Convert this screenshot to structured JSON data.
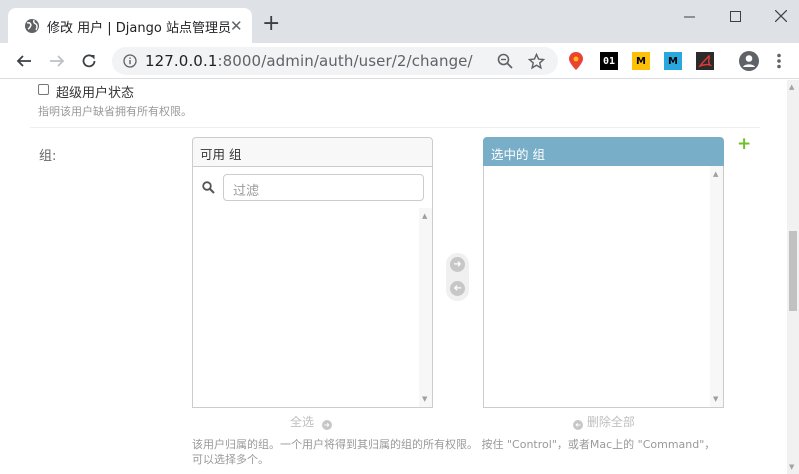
{
  "browser": {
    "tab_title": "修改 用户 | Django 站点管理员",
    "tab_close": "✕",
    "new_tab": "+",
    "url_host": "127.0.0.1",
    "url_rest": ":8000/admin/auth/user/2/change/",
    "extensions": [
      {
        "name": "maps-pin",
        "label": "",
        "bg": "#ffffff",
        "fg": "#ea4335"
      },
      {
        "name": "01",
        "label": "01",
        "bg": "#000000",
        "fg": "#ffffff"
      },
      {
        "name": "m-yellow",
        "label": "M",
        "bg": "#ffc107",
        "fg": "#000000"
      },
      {
        "name": "m-blue",
        "label": "M",
        "bg": "#29a8e0",
        "fg": "#000000"
      },
      {
        "name": "pdf",
        "label": "",
        "bg": "#2b2b2b",
        "fg": "#e53935"
      }
    ]
  },
  "form": {
    "superuser_label": "超级用户状态",
    "superuser_help": "指明该用户缺省拥有所有权限。",
    "groups_label": "组:",
    "available": {
      "title": "可用 组",
      "filter_placeholder": "过滤",
      "choose_all": "全选"
    },
    "chosen": {
      "title": "选中的 组",
      "remove_all": "删除全部"
    },
    "groups_help_line1": "该用户归属的组。一个用户将得到其归属的组的所有权限。 按住 \"Control\"，或者Mac上的 \"Command\"，",
    "groups_help_line2": "可以选择多个。",
    "add_symbol": "+"
  },
  "colors": {
    "chosen_header": "#79aec8",
    "add_green": "#70bf2b",
    "disabled_gray": "#c7c7c7",
    "available_header": "#f8f8f8"
  }
}
